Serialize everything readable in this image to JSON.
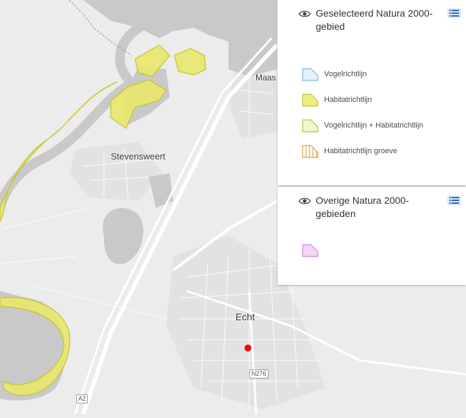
{
  "map": {
    "labels": {
      "stevensweert": "Stevensweert",
      "echt": "Echt",
      "maas": "Maas"
    },
    "shields": {
      "n276": "N276",
      "a2": "A2"
    },
    "colors": {
      "background": "#ececec",
      "water": "#cbcbcb",
      "natura_fill": "#e9e86c",
      "natura_stroke": "#c9c62c",
      "marker": "#ff0000"
    }
  },
  "legend": {
    "geselecteerd": {
      "title": "Geselecteerd Natura 2000-gebied",
      "items": [
        {
          "label": "Vogelrichtlijn",
          "icon": "swatch-blue-polygon",
          "fill": "#e3f1fb",
          "stroke": "#7fb6e0"
        },
        {
          "label": "Habitatrichtlijn",
          "icon": "swatch-yellow-polygon",
          "fill": "#eeec86",
          "stroke": "#c9c22e"
        },
        {
          "label": "Vogelrichtlijn + Habitatrichtlijn",
          "icon": "swatch-green-polygon",
          "fill": "#eef8cf",
          "stroke": "#9ccc3c"
        },
        {
          "label": "Habitatrichtlijn groeve",
          "icon": "swatch-orange-hatched-polygon",
          "fill": "#ffffff",
          "stroke": "#e39a3a"
        }
      ]
    },
    "overige": {
      "title": "Overige Natura 2000-gebieden",
      "items": [
        {
          "label": "",
          "icon": "swatch-pink-polygon",
          "fill": "#f5d7f5",
          "stroke": "#cc88dd"
        }
      ]
    }
  }
}
